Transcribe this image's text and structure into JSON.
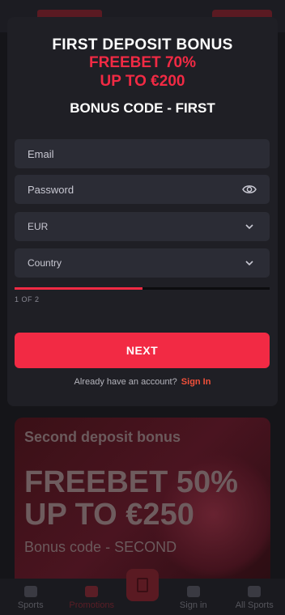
{
  "modal": {
    "title_line1": "FIRST DEPOSIT BONUS",
    "title_line2": "FREEBET 70%",
    "title_line3": "UP TO €200",
    "bonus_code": "BONUS CODE - FIRST",
    "email_placeholder": "Email",
    "password_placeholder": "Password",
    "currency_value": "EUR",
    "country_value": "Country",
    "progress": 0.5,
    "step_text": "1 OF 2",
    "next_label": "NEXT",
    "login_prompt": "Already have an account?",
    "sign_in_label": "Sign In"
  },
  "promo": {
    "title": "Second deposit bonus",
    "line1": "FREEBET 50%",
    "line2": "UP TO €250",
    "code": "Bonus code - SECOND"
  },
  "nav": {
    "sports": "Sports",
    "promotions": "Promotions",
    "sign_in": "Sign in",
    "all_sports": "All Sports"
  },
  "colors": {
    "accent": "#f22a44",
    "modal_bg": "#1f1f25",
    "field_bg": "#2b2c35"
  }
}
